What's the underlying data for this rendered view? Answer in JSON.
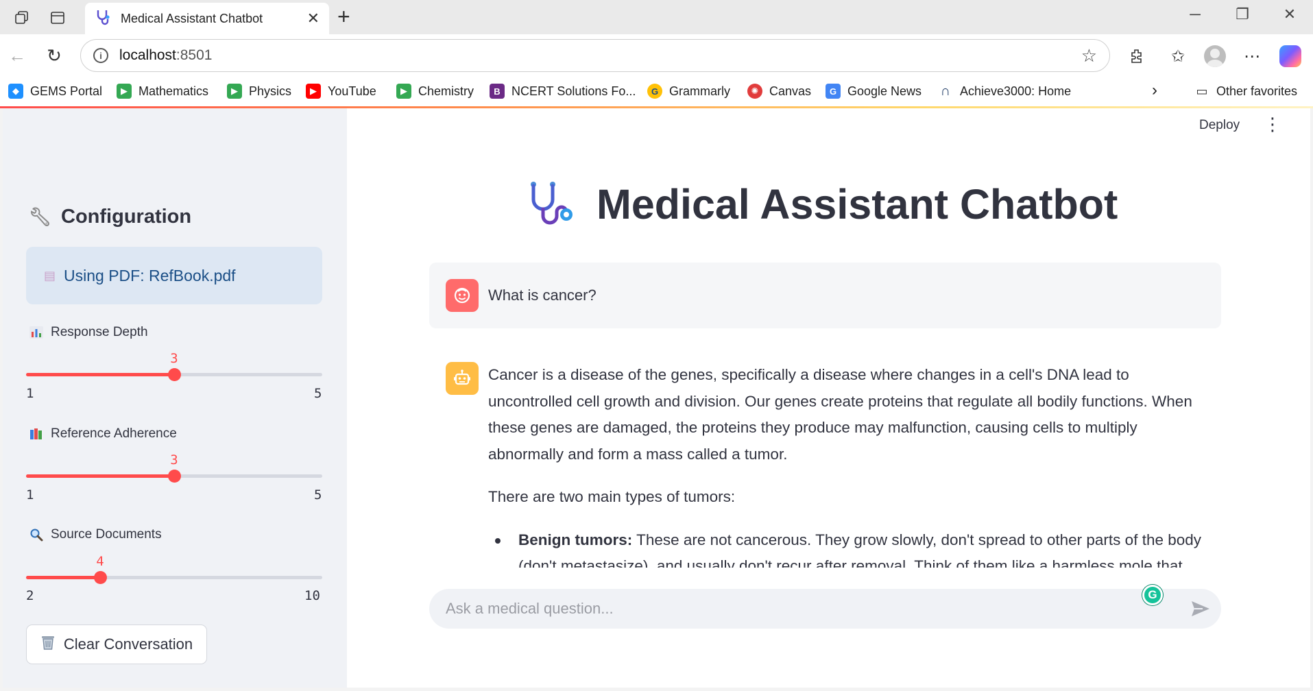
{
  "browser": {
    "tab": {
      "title": "Medical Assistant Chatbot"
    },
    "address": {
      "host": "localhost",
      "port": ":8501"
    },
    "bookmarks": [
      {
        "label": "GEMS Portal",
        "color": "#1e90ff"
      },
      {
        "label": "Mathematics",
        "color": "#34a853"
      },
      {
        "label": "Physics",
        "color": "#34a853"
      },
      {
        "label": "YouTube",
        "color": "#ff0000"
      },
      {
        "label": "Chemistry",
        "color": "#34a853"
      },
      {
        "label": "NCERT Solutions Fo...",
        "color": "#6b2a86"
      },
      {
        "label": "Grammarly",
        "color": "#15c39a"
      },
      {
        "label": "Canvas",
        "color": "#e13c3c"
      },
      {
        "label": "Google News",
        "color": "#4285f4"
      },
      {
        "label": "Achieve3000: Home",
        "color": "#1f3b66"
      }
    ],
    "other_favorites": "Other favorites"
  },
  "sidebar": {
    "heading": "Configuration",
    "pdf_notice": "Using PDF: RefBook.pdf",
    "sliders": [
      {
        "label": "Response Depth",
        "value": "3",
        "min": "1",
        "max": "5"
      },
      {
        "label": "Reference Adherence",
        "value": "3",
        "min": "1",
        "max": "5"
      },
      {
        "label": "Source Documents",
        "value": "4",
        "min": "2",
        "max": "10"
      }
    ],
    "clear_button": "Clear Conversation"
  },
  "main": {
    "deploy": "Deploy",
    "title": "Medical Assistant Chatbot",
    "user_message": "What is cancer?",
    "assistant_message": {
      "paragraph1": "Cancer is a disease of the genes, specifically a disease where changes in a cell's DNA lead to uncontrolled cell growth and division. Our genes create proteins that regulate all bodily functions. When these genes are damaged, the proteins they produce may malfunction, causing cells to multiply abnormally and form a mass called a tumor.",
      "paragraph2": "There are two main types of tumors:",
      "bullet1_label": "Benign tumors:",
      "bullet1_text": " These are not cancerous. They grow slowly, don't spread to other parts of the body (don't metastasize), and usually don't recur after removal. Think of them like a harmless mole that"
    },
    "chat_input_placeholder": "Ask a medical question..."
  },
  "colors": {
    "accent": "#ff4b4b",
    "sidebar_bg": "#f0f2f6",
    "pdf_notice_bg": "#dde7f3",
    "user_avatar": "#ff6b6b",
    "assistant_avatar": "#ffbd45"
  }
}
